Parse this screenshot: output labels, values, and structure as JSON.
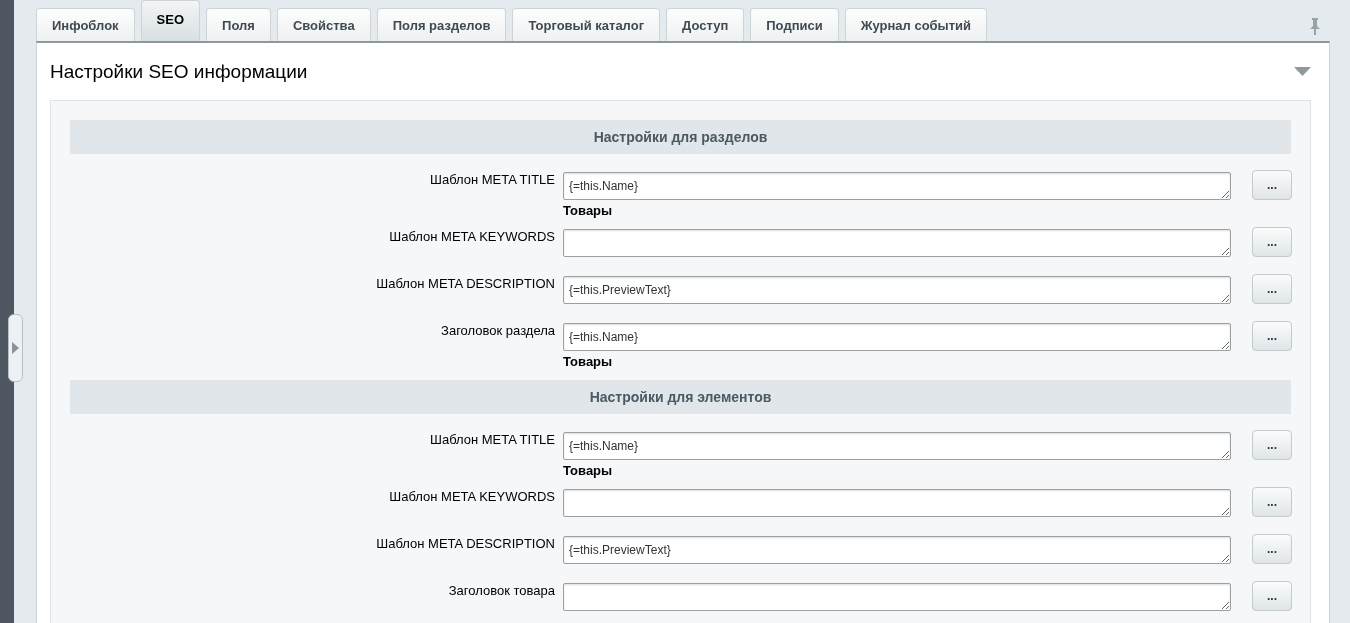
{
  "tabs": [
    {
      "label": "Инфоблок",
      "selected": false
    },
    {
      "label": "SEO",
      "selected": true
    },
    {
      "label": "Поля",
      "selected": false
    },
    {
      "label": "Свойства",
      "selected": false
    },
    {
      "label": "Поля разделов",
      "selected": false
    },
    {
      "label": "Торговый каталог",
      "selected": false
    },
    {
      "label": "Доступ",
      "selected": false
    },
    {
      "label": "Подписи",
      "selected": false
    },
    {
      "label": "Журнал событий",
      "selected": false
    }
  ],
  "panel": {
    "title": "Настройки SEO информации",
    "expanded": true,
    "sections": [
      {
        "title": "Настройки для разделов",
        "fields": [
          {
            "label": "Шаблон META TITLE",
            "value": "{=this.Name}",
            "hint": "Товары",
            "button": "..."
          },
          {
            "label": "Шаблон META KEYWORDS",
            "button": "..."
          },
          {
            "label": "Шаблон META DESCRIPTION",
            "value": "{=this.PreviewText}",
            "button": "..."
          },
          {
            "label": "Заголовок раздела",
            "value": "{=this.Name}",
            "hint": "Товары",
            "button": "..."
          }
        ]
      },
      {
        "title": "Настройки для элементов",
        "fields": [
          {
            "label": "Шаблон META TITLE",
            "value": "{=this.Name}",
            "hint": "Товары",
            "button": "..."
          },
          {
            "label": "Шаблон META KEYWORDS",
            "button": "..."
          },
          {
            "label": "Шаблон META DESCRIPTION",
            "value": "{=this.PreviewText}",
            "button": "..."
          },
          {
            "label": "Заголовок товара",
            "button": "..."
          }
        ]
      }
    ]
  }
}
